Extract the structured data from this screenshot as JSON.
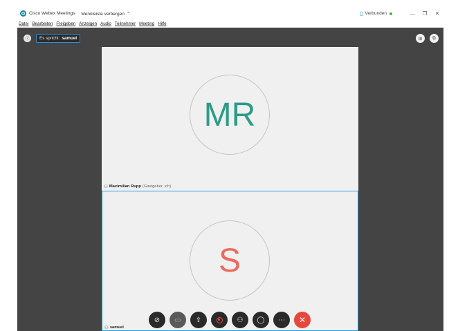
{
  "titlebar": {
    "app_name": "Cisco Webex Meetings",
    "menu_toggle": "Menüleiste verbergen",
    "status": "Verbunden",
    "minimize": "—",
    "restore": "❐",
    "close": "✕"
  },
  "menu": [
    {
      "label": "Datei"
    },
    {
      "label": "Bearbeiten"
    },
    {
      "label": "Freigeben"
    },
    {
      "label": "Anzeigen"
    },
    {
      "label": "Audio"
    },
    {
      "label": "Teilnehmer"
    },
    {
      "label": "Meeting"
    },
    {
      "label": "Hilfe"
    }
  ],
  "stage": {
    "speaker_prefix": "Es spricht:",
    "speaker_name": "samuel"
  },
  "tiles": [
    {
      "initials": "MR",
      "name": "Maximilian Rupp",
      "role": "(Gastgeber, ich)",
      "color": "#2e9b87"
    },
    {
      "initials": "S",
      "name": "samuel",
      "role": "",
      "color": "#ec6a5e"
    }
  ],
  "colors": {
    "stage_bg": "#444444",
    "active_border": "#1fa2db",
    "end_button": "#e8483b"
  },
  "controls": [
    {
      "icon": "mute-mic-icon"
    },
    {
      "icon": "video-off-icon"
    },
    {
      "icon": "share-icon"
    },
    {
      "icon": "record-icon"
    },
    {
      "icon": "participants-icon"
    },
    {
      "icon": "chat-icon"
    },
    {
      "icon": "more-icon"
    },
    {
      "icon": "end-meeting-icon"
    }
  ]
}
